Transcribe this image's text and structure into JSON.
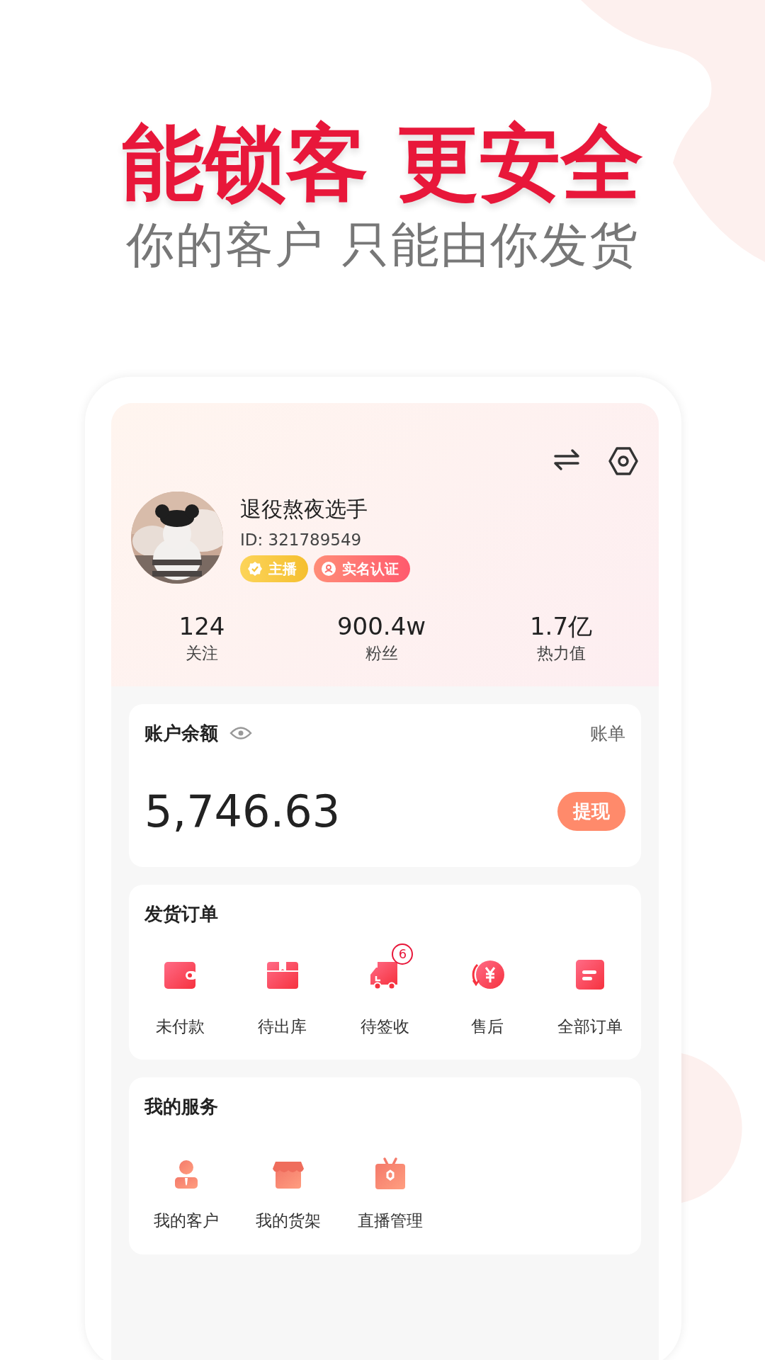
{
  "headline": "能锁客 更安全",
  "subheadline": "你的客户 只能由你发货",
  "profile": {
    "name": "退役熬夜选手",
    "id": "ID: 321789549",
    "badges": [
      "主播",
      "实名认证"
    ],
    "stats": [
      {
        "value": "124",
        "label": "关注"
      },
      {
        "value": "900.4w",
        "label": "粉丝"
      },
      {
        "value": "1.7亿",
        "label": "热力值"
      }
    ]
  },
  "balance": {
    "title": "账户余额",
    "link": "账单",
    "amount": "5,746.63",
    "button": "提现"
  },
  "orders": {
    "title": "发货订单",
    "items": [
      {
        "label": "未付款"
      },
      {
        "label": "待出库"
      },
      {
        "label": "待签收",
        "badge": "6"
      },
      {
        "label": "售后"
      },
      {
        "label": "全部订单"
      }
    ]
  },
  "services": {
    "title": "我的服务",
    "items": [
      {
        "label": "我的客户"
      },
      {
        "label": "我的货架"
      },
      {
        "label": "直播管理"
      }
    ]
  }
}
